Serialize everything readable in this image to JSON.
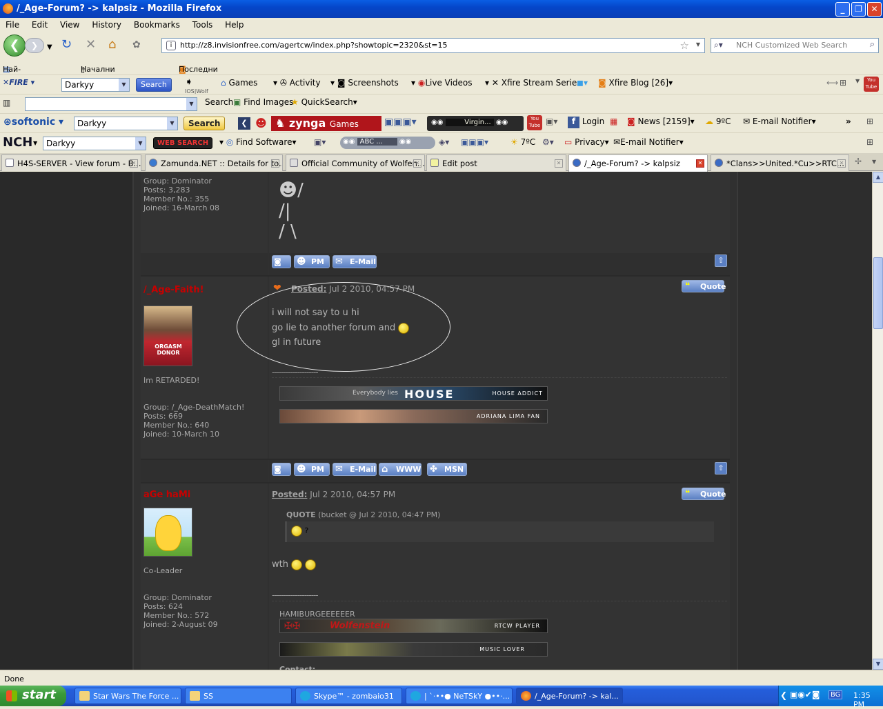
{
  "window": {
    "title": "/_Age-Forum? -> kalpsiz - Mozilla Firefox"
  },
  "menu": [
    "File",
    "Edit",
    "View",
    "History",
    "Bookmarks",
    "Tools",
    "Help"
  ],
  "nav": {
    "url": "http://z8.invisionfree.com/agertcw/index.php?showtopic=2320&st=15",
    "search_placeholder": "NCH Customized Web Search"
  },
  "bookmarks": [
    "Най-посещавани",
    "Начални насоки на Fi...",
    "Последни новини"
  ],
  "toolbars": {
    "xfire": {
      "combo": "Darkyy",
      "search": "Search",
      "games": "Games",
      "activity": "Activity",
      "screenshots": "Screenshots",
      "live": "Live Videos",
      "stream": "Xfire Stream Series",
      "blog": "Xfire Blog [26]",
      "under": "IOS|Wolf"
    },
    "row2": {
      "search": "Search",
      "images": "Find Images",
      "quick": "QuickSearch"
    },
    "softonic": {
      "combo": "Darkyy",
      "search": "Search",
      "zynga": "zynga",
      "games": "Games",
      "virgin": "Virgin...",
      "login": "Login",
      "news": "News [2159]",
      "temp": "9ºC",
      "email": "E-mail Notifier"
    },
    "nch": {
      "combo": "Darkyy",
      "websearch": "WEB SEARCH",
      "findsoft": "Find Software",
      "abc": "ABC ...",
      "temp": "7ºC",
      "privacy": "Privacy",
      "email": "E-mail Notifier"
    }
  },
  "tabs": [
    {
      "label": "H4S-SERVER - View forum - B..."
    },
    {
      "label": "Zamunda.NET :: Details for to..."
    },
    {
      "label": "Official Community of Wolfen..."
    },
    {
      "label": "Edit post"
    },
    {
      "label": "/_Age-Forum? -> kalpsiz"
    },
    {
      "label": "*Clans>>United.*Cu>>RTC..."
    }
  ],
  "post0": {
    "group": "Group: Dominator",
    "posts": "Posts: 3,283",
    "member": "Member No.: 355",
    "joined": "Joined: 16-March 08",
    "stick": "☻/\n/|\n/ \\"
  },
  "post1": {
    "author": "/_Age-Faith!",
    "avatar_text": "ORGASM DONOR",
    "title": "Im RETARDED!",
    "group": "Group: /_Age-DeathMatch!",
    "posts": "Posts: 669",
    "member": "Member No.: 640",
    "joined": "Joined: 10-March 10",
    "posted_label": "Posted:",
    "posted_date": "Jul 2 2010, 04:57 PM",
    "lines": [
      "i will not say to u hi",
      "go lie to another forum and",
      "gl in future"
    ],
    "sig1": "HOUSE",
    "sig1_tag": "HOUSE ADDICT",
    "sig1_mid": "Everybody lies",
    "sig2_tag": "ADRIANA LIMA FAN"
  },
  "post2": {
    "author": "aGe haMi",
    "title": "Co-Leader",
    "group": "Group: Dominator",
    "posts": "Posts: 624",
    "member": "Member No.: 572",
    "joined": "Joined: 2-August 09",
    "posted_label": "Posted:",
    "posted_date": "Jul 2 2010, 04:57 PM",
    "quote_label": "QUOTE",
    "quote_meta": "(bucket @ Jul 2 2010, 04:47 PM)",
    "quote_text": "?",
    "body": "wth",
    "sig_name": "HAMIBURGEEEEEER",
    "sig1": "Wolfenstein",
    "sig1_tag": "RTCW PLAYER",
    "sig2_tag": "MUSIC LOVER",
    "contact": "Contact:"
  },
  "buttons": {
    "pm": "PM",
    "email": "E-Mail",
    "www": "WWW",
    "msn": "MSN",
    "quote": "Quote"
  },
  "dashes": "--------------------",
  "status": "Done",
  "taskbar": {
    "start": "start",
    "items": [
      "Star Wars The Force ...",
      "SS",
      "Skype™ - zombaio31",
      "| `·••● NeTSkY ●••·...",
      "/_Age-Forum? -> kal..."
    ],
    "lang": "BG",
    "time": "1:35 PM"
  }
}
